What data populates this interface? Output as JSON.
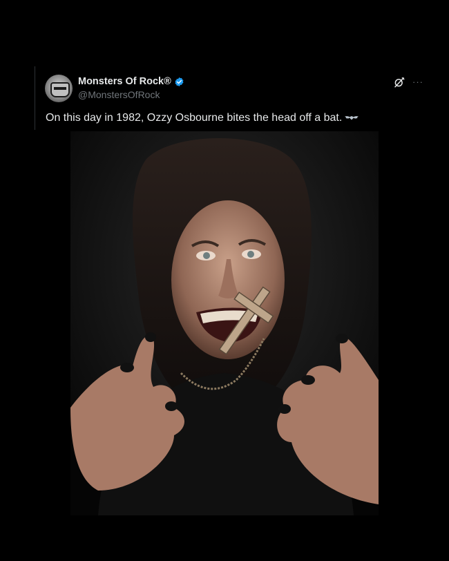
{
  "tweet": {
    "author": {
      "display_name": "Monsters Of Rock®",
      "handle": "@MonstersOfRock",
      "verified": true,
      "avatar_icon": "monsters-of-rock-logo-icon"
    },
    "text": "On this day in 1982, Ozzy Osbourne bites the head off a bat.",
    "text_emoji": "bat-emoji",
    "actions": {
      "grok_icon": "grok-icon",
      "more_label": "···"
    },
    "media": {
      "type": "photo",
      "subject": "photo-of-man-with-cross-in-mouth"
    }
  },
  "colors": {
    "background": "#000000",
    "text_primary": "#e7e9ea",
    "text_secondary": "#71767b",
    "verified_blue": "#1d9bf0"
  }
}
